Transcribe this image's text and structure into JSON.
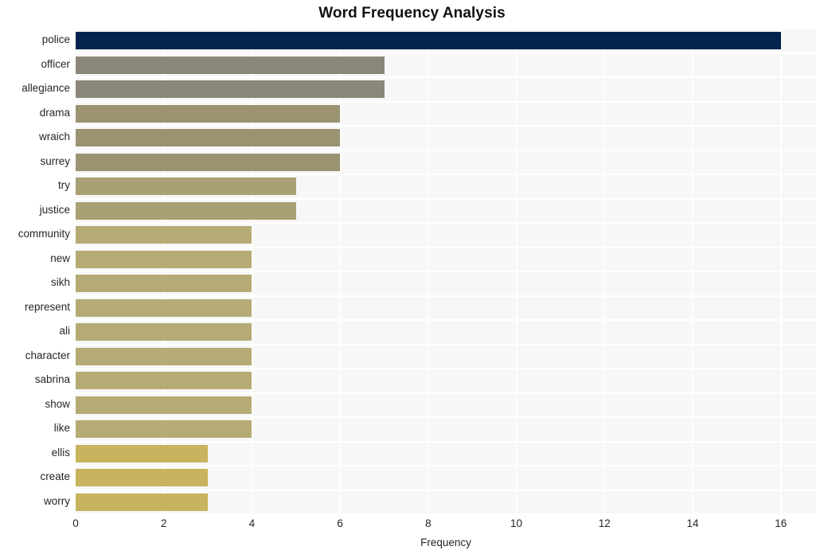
{
  "chart_data": {
    "type": "bar",
    "orientation": "horizontal",
    "title": "Word Frequency Analysis",
    "xlabel": "Frequency",
    "ylabel": "",
    "xlim": [
      0,
      16.8
    ],
    "ylim": null,
    "grid": true,
    "legend": null,
    "xticks": [
      0,
      2,
      4,
      6,
      8,
      10,
      12,
      14,
      16
    ],
    "xtick_labels": [
      "0",
      "2",
      "4",
      "6",
      "8",
      "10",
      "12",
      "14",
      "16"
    ],
    "categories": [
      "police",
      "officer",
      "allegiance",
      "drama",
      "wraich",
      "surrey",
      "try",
      "justice",
      "community",
      "new",
      "sikh",
      "represent",
      "ali",
      "character",
      "sabrina",
      "show",
      "like",
      "ellis",
      "create",
      "worry"
    ],
    "values": [
      16,
      7,
      7,
      6,
      6,
      6,
      5,
      5,
      4,
      4,
      4,
      4,
      4,
      4,
      4,
      4,
      4,
      3,
      3,
      3
    ],
    "bar_colors": [
      "#03244f",
      "#8a8779",
      "#8a8779",
      "#9a9270",
      "#9a9270",
      "#9a9270",
      "#a9a074",
      "#a9a074",
      "#b5ab74",
      "#b5ab74",
      "#b5ab74",
      "#b5ab74",
      "#b5ab74",
      "#b5ab74",
      "#b5ab74",
      "#b5ab74",
      "#b5ab74",
      "#c8b45e",
      "#c8b45e",
      "#c8b45e"
    ],
    "plot_background": "#f7f7f7",
    "gridline_color": "#ffffff",
    "page_background": "#ffffff",
    "text_color": "#262626",
    "title_color": "#111111"
  }
}
